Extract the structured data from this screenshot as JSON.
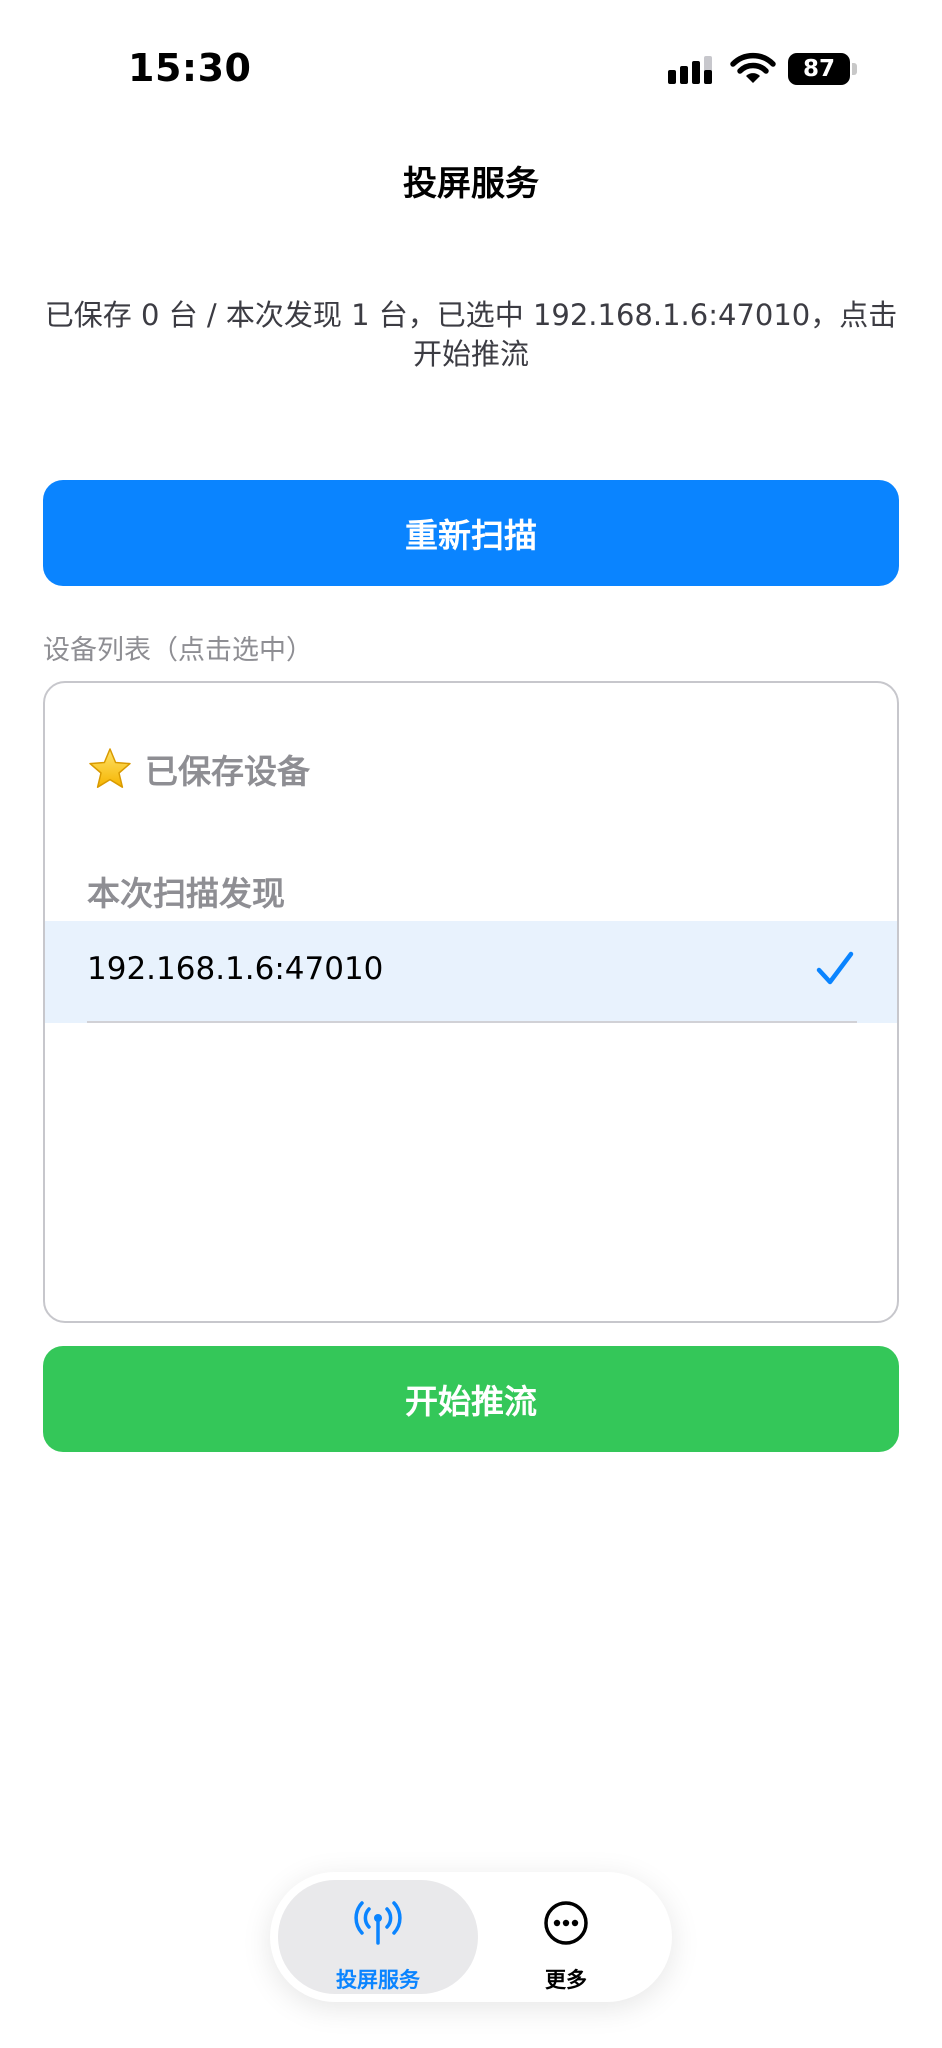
{
  "status_bar": {
    "time": "15:30",
    "battery_level": "87",
    "icons": [
      "signal-icon",
      "wifi-icon",
      "battery-icon"
    ]
  },
  "nav": {
    "title": "投屏服务"
  },
  "status_message": "已保存 0 台 / 本次发现 1 台，已选中 192.168.1.6:47010，点击开始推流",
  "buttons": {
    "rescan": "重新扫描",
    "start": "开始推流"
  },
  "device_list": {
    "caption": "设备列表（点击选中）",
    "saved_header": "已保存设备",
    "scan_header": "本次扫描发现",
    "devices": [
      {
        "address": "192.168.1.6:47010",
        "selected": true
      }
    ]
  },
  "tab_bar": {
    "tabs": [
      {
        "label": "投屏服务",
        "icon": "antenna-icon",
        "active": true
      },
      {
        "label": "更多",
        "icon": "more-icon",
        "active": false
      }
    ]
  },
  "colors": {
    "primary_blue": "#0a84ff",
    "success_green": "#34c759",
    "selected_row": "#e8f2fd",
    "secondary_text": "#8e8e93"
  }
}
